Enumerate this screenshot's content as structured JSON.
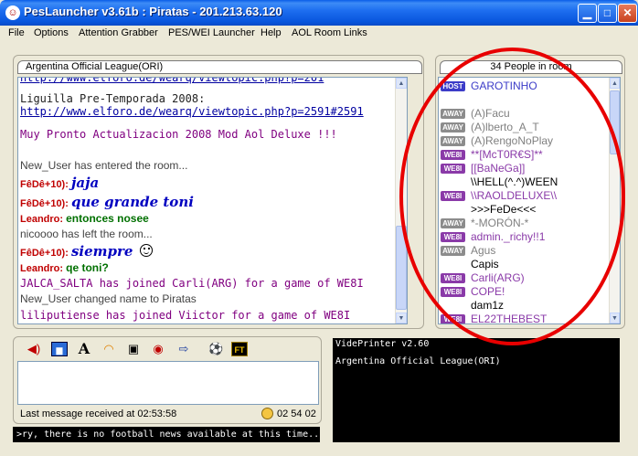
{
  "window": {
    "title": "PesLauncher v3.61b : Piratas - 201.213.63.120"
  },
  "menu": [
    "File",
    "Options",
    "Attention Grabber",
    "PES/WEI Launcher",
    "Help",
    "AOL Room Links"
  ],
  "chat": {
    "room_title": "Argentina Official League(ORI)",
    "lines": {
      "cut": "http://www.elforo.de/wearq/viewtopic.php?p=201",
      "liguilla": "Liguilla Pre-Temporada 2008:",
      "link": "http://www.elforo.de/wearq/viewtopic.php?p=2591#2591",
      "pronto": "Muy Pronto Actualizacion 2008 Mod Aol Deluxe !!!",
      "entered": "New_User has entered the room...",
      "nick1": "FêDê+10):",
      "msg1": "jaja",
      "nick2": "FêDê+10):",
      "msg2": "que grande toni",
      "nick3": "Leandro:",
      "msg3": "entonces nosee",
      "left": "nicoooo has left the room...",
      "nick4": "FêDê+10):",
      "msg4": "siempre",
      "nick5": "Leandro:",
      "msg5": "qe toni?",
      "joined1": "JALCA_SALTA has joined Carli(ARG) for a game of WE8I",
      "renamed": "New_User changed name to Piratas",
      "joined2": "liliputiense has joined Viictor for a game of WE8I"
    }
  },
  "users": {
    "header": "34 People in room",
    "list": [
      {
        "badge": "HOST",
        "name": "GAROTINHO",
        "color": "#3c3cc8"
      },
      {
        "badge": "",
        "name": "",
        "color": "#555555"
      },
      {
        "badge": "AWAY",
        "name": "(A)Facu",
        "color": "#808080"
      },
      {
        "badge": "AWAY",
        "name": "(A)lberto_A_T",
        "color": "#808080"
      },
      {
        "badge": "AWAY",
        "name": "(A)RengoNoPlay",
        "color": "#808080"
      },
      {
        "badge": "WE8I",
        "name": "**[McT0R€S]**",
        "color": "#8a3aa8"
      },
      {
        "badge": "WE8I",
        "name": "[[BaNeGa]]",
        "color": "#8a3aa8"
      },
      {
        "badge": "",
        "name": "\\\\HELL(^.^)WEEN",
        "color": "#000000"
      },
      {
        "badge": "WE8I",
        "name": "\\\\RAOLDELUXE\\\\",
        "color": "#8a3aa8"
      },
      {
        "badge": "",
        "name": ">>>FeDe<<<",
        "color": "#000000"
      },
      {
        "badge": "AWAY",
        "name": "*-MORÓN-*",
        "color": "#808080"
      },
      {
        "badge": "WE8I",
        "name": "admin._richy!!1",
        "color": "#8a3aa8"
      },
      {
        "badge": "AWAY",
        "name": "Agus",
        "color": "#808080"
      },
      {
        "badge": "",
        "name": "Capis",
        "color": "#000000"
      },
      {
        "badge": "WE8I",
        "name": "Carli(ARG)",
        "color": "#8a3aa8"
      },
      {
        "badge": "WE8I",
        "name": "COPE!",
        "color": "#8a3aa8"
      },
      {
        "badge": "",
        "name": "dam1z",
        "color": "#000000"
      },
      {
        "badge": "WE8I",
        "name": "EL22THEBEST",
        "color": "#8a3aa8"
      }
    ]
  },
  "toolbar": {
    "icons": [
      "speaker-icon",
      "picture-icon",
      "font-icon",
      "rainbow-icon",
      "trash-icon",
      "stop-icon",
      "exit-icon",
      "football-icon",
      "ft-icon"
    ],
    "font_glyph": "A",
    "ft_label": "FT"
  },
  "status": {
    "last_message": "Last message received at 02:53:58",
    "time": "02 54 02"
  },
  "ticker": ">ry, there is no football news available at this time..",
  "videprinter": {
    "title": "VidePrinter v2.60",
    "line1": "Argentina Official League(ORI)"
  },
  "colors": {
    "host_badge": "#3c3cc8",
    "away_badge": "#8c8c8c",
    "we8i_badge": "#8a3aa8",
    "highlight": "#e80000"
  }
}
